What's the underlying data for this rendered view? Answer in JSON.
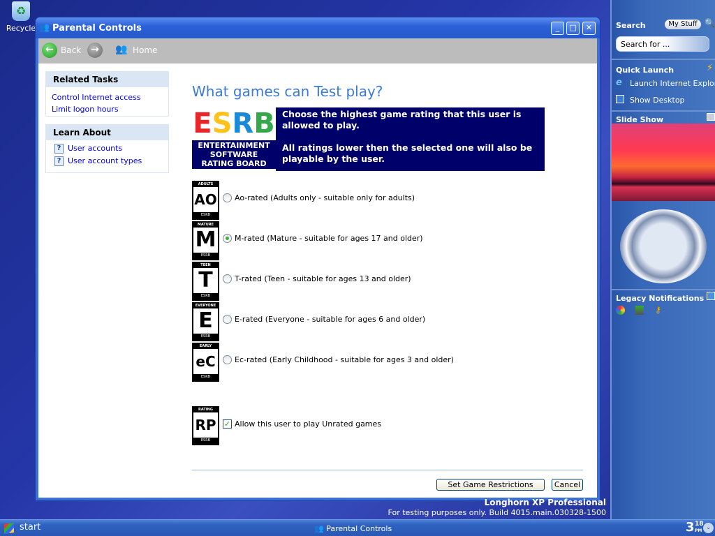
{
  "desktop": {
    "recycle_label": "Recycle",
    "watermark_title": "Longhorn XP Professional",
    "watermark_build": "For testing purposes only. Build 4015.main.030328-1500"
  },
  "window": {
    "title": "Parental Controls",
    "minimize": "_",
    "maximize": "□",
    "close": "✕"
  },
  "toolbar": {
    "back": "Back",
    "home": "Home"
  },
  "left_panel": {
    "related_tasks": {
      "title": "Related Tasks",
      "items": [
        "Control Internet access",
        "Limit logon hours"
      ]
    },
    "learn_about": {
      "title": "Learn About",
      "items": [
        "User accounts",
        "User account types"
      ]
    }
  },
  "main": {
    "heading": "What games can Test play?",
    "esrb_logo": {
      "letters": "ESRB",
      "line1": "ENTERTAINMENT",
      "line2": "SOFTWARE",
      "line3": "RATING BOARD"
    },
    "esrb_text1": "Choose the highest game rating that this user is allowed to play.",
    "esrb_text2": "All ratings lower then the selected one will also be playable by the user.",
    "ratings": [
      {
        "badge_top": "ADULTS ONLY",
        "badge_letter": "AO",
        "label": "Ao-rated (Adults only - suitable only for adults)",
        "selected": false
      },
      {
        "badge_top": "MATURE",
        "badge_letter": "M",
        "label": "M-rated (Mature - suitable for ages 17 and older)",
        "selected": true
      },
      {
        "badge_top": "TEEN",
        "badge_letter": "T",
        "label": "T-rated (Teen - suitable for ages 13 and older)",
        "selected": false
      },
      {
        "badge_top": "EVERYONE",
        "badge_letter": "E",
        "label": "E-rated (Everyone - suitable for ages 6 and older)",
        "selected": false
      },
      {
        "badge_top": "EARLY CHILDHOOD",
        "badge_letter": "eC",
        "label": "Ec-rated (Early Childhood - suitable for ages 3 and older)",
        "selected": false
      }
    ],
    "badge_bottom": "ESRB",
    "unrated": {
      "badge_top": "RATING PENDING",
      "badge_letter": "RP",
      "label": "Allow this user to play Unrated games",
      "checked": true
    },
    "set_button": "Set Game Restrictions",
    "cancel_button": "Cancel"
  },
  "sidebar": {
    "search_title": "Search",
    "my_stuff": "My Stuff",
    "search_placeholder": "Search for ...",
    "quick_launch_title": "Quick Launch",
    "quick_launch_items": [
      "Launch Internet Explorer",
      "Show Desktop"
    ],
    "slideshow_title": "Slide Show",
    "legacy_title": "Legacy Notifications"
  },
  "taskbar": {
    "start": "start",
    "task": "Parental Controls",
    "clock_hour": "3",
    "clock_min": "18",
    "clock_ampm": "PM"
  }
}
